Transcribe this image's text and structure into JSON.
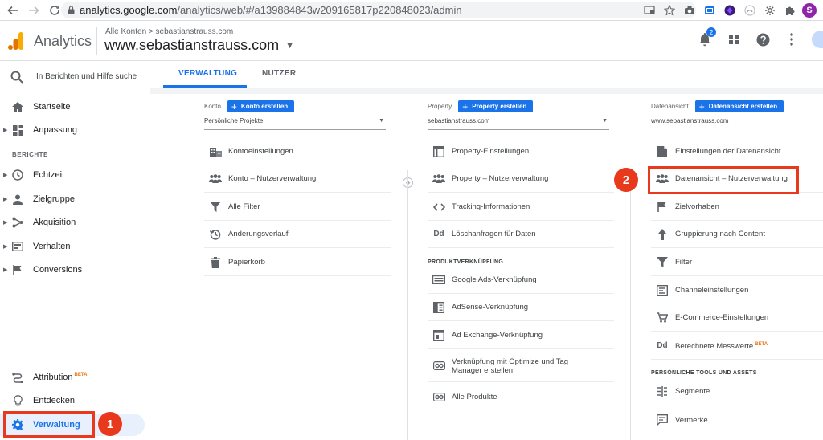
{
  "browser": {
    "url_host": "analytics.google.com",
    "url_path": "/analytics/web/#/a139884843w209165817p220848023/admin",
    "profile_initial": "S"
  },
  "header": {
    "app_name": "Analytics",
    "breadcrumb": "Alle Konten > sebastianstrauss.com",
    "view_name": "www.sebastianstrauss.com",
    "notification_count": "2"
  },
  "sidebar": {
    "search_placeholder": "In Berichten und Hilfe suche",
    "top_items": [
      {
        "label": "Startseite"
      },
      {
        "label": "Anpassung"
      }
    ],
    "section_label": "BERICHTE",
    "report_items": [
      {
        "label": "Echtzeit"
      },
      {
        "label": "Zielgruppe"
      },
      {
        "label": "Akquisition"
      },
      {
        "label": "Verhalten"
      },
      {
        "label": "Conversions"
      }
    ],
    "bottom_items": [
      {
        "label": "Attribution",
        "badge": "BETA"
      },
      {
        "label": "Entdecken"
      },
      {
        "label": "Verwaltung"
      }
    ]
  },
  "annotations": {
    "badge_1": "1",
    "badge_2": "2"
  },
  "tabs": [
    {
      "label": "VERWALTUNG",
      "active": true
    },
    {
      "label": "NUTZER",
      "active": false
    }
  ],
  "columns": {
    "konto": {
      "title": "Konto",
      "create_label": "Konto erstellen",
      "selected": "Persönliche Projekte",
      "items": [
        {
          "label": "Kontoeinstellungen",
          "icon": "building-icon"
        },
        {
          "label": "Konto – Nutzerverwaltung",
          "icon": "people-icon"
        },
        {
          "label": "Alle Filter",
          "icon": "filter-icon"
        },
        {
          "label": "Änderungsverlauf",
          "icon": "history-icon"
        },
        {
          "label": "Papierkorb",
          "icon": "trash-icon"
        }
      ]
    },
    "property": {
      "title": "Property",
      "create_label": "Property erstellen",
      "selected": "sebastianstrauss.com",
      "items": [
        {
          "label": "Property-Einstellungen",
          "icon": "window-icon"
        },
        {
          "label": "Property – Nutzerverwaltung",
          "icon": "people-icon"
        },
        {
          "label": "Tracking-Informationen",
          "icon": "code-icon"
        },
        {
          "label": "Löschanfragen für Daten",
          "icon": "dd-icon"
        }
      ],
      "section_label": "PRODUKTVERKNÜPFUNG",
      "link_items": [
        {
          "label": "Google Ads-Verknüpfung",
          "icon": "ads-icon"
        },
        {
          "label": "AdSense-Verknüpfung",
          "icon": "adsense-icon"
        },
        {
          "label": "Ad Exchange-Verknüpfung",
          "icon": "adexchange-icon"
        },
        {
          "label": "Verknüpfung mit Optimize und Tag",
          "label2": "Manager erstellen",
          "icon": "link-icon"
        },
        {
          "label": "Alle Produkte",
          "icon": "link-icon"
        }
      ]
    },
    "datenansicht": {
      "title": "Datenansicht",
      "create_label": "Datenansicht erstellen",
      "selected": "www.sebastianstrauss.com",
      "items": [
        {
          "label": "Einstellungen der Datenansicht",
          "icon": "document-icon"
        },
        {
          "label": "Datenansicht – Nutzerverwaltung",
          "icon": "people-icon"
        },
        {
          "label": "Zielvorhaben",
          "icon": "flag-icon"
        },
        {
          "label": "Gruppierung nach Content",
          "icon": "person-walk-icon"
        },
        {
          "label": "Filter",
          "icon": "filter-icon"
        },
        {
          "label": "Channeleinstellungen",
          "icon": "channel-icon"
        },
        {
          "label": "E-Commerce-Einstellungen",
          "icon": "cart-icon"
        },
        {
          "label": "Berechnete Messwerte",
          "badge": "BETA",
          "icon": "dd-icon"
        }
      ],
      "section_label": "PERSÖNLICHE TOOLS UND ASSETS",
      "tool_items": [
        {
          "label": "Segmente",
          "icon": "segments-icon"
        },
        {
          "label": "Vermerke",
          "icon": "notes-icon"
        }
      ]
    }
  },
  "colors": {
    "accent": "#1a73e8",
    "highlight": "#e8391d"
  }
}
